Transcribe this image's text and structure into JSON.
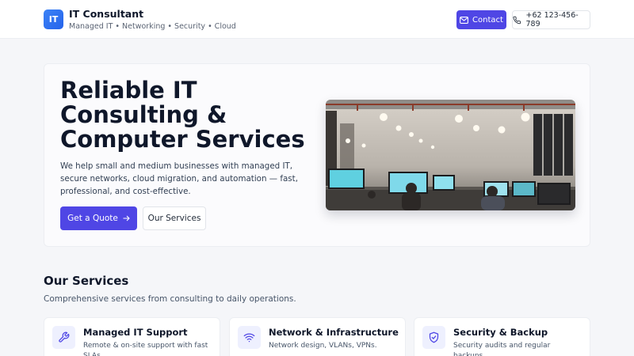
{
  "header": {
    "logo_text": "IT",
    "brand_title": "IT Consultant",
    "brand_subtitle": "Managed IT • Networking • Security • Cloud",
    "contact_label": "Contact",
    "phone_label": "+62 123-456-789"
  },
  "hero": {
    "title": "Reliable IT Consulting & Computer Services",
    "description": "We help small and medium businesses with managed IT, secure networks, cloud migration, and automation — fast, professional, and cost-effective.",
    "primary_cta": "Get a Quote",
    "secondary_cta": "Our Services",
    "image_subject": "office-workspace-photo"
  },
  "services": {
    "title": "Our Services",
    "subtitle": "Comprehensive services from consulting to daily operations.",
    "items": [
      {
        "title": "Managed IT Support",
        "description": "Remote & on-site support with fast SLAs.",
        "icon": "wrench-icon"
      },
      {
        "title": "Network & Infrastructure",
        "description": "Network design, VLANs, VPNs.",
        "icon": "wifi-icon"
      },
      {
        "title": "Security & Backup",
        "description": "Security audits and regular backups.",
        "icon": "shield-icon"
      }
    ]
  },
  "colors": {
    "accent": "#4f46e5",
    "logo": "#2563eb",
    "background": "#f5f6f9",
    "text": "#0f172a"
  }
}
